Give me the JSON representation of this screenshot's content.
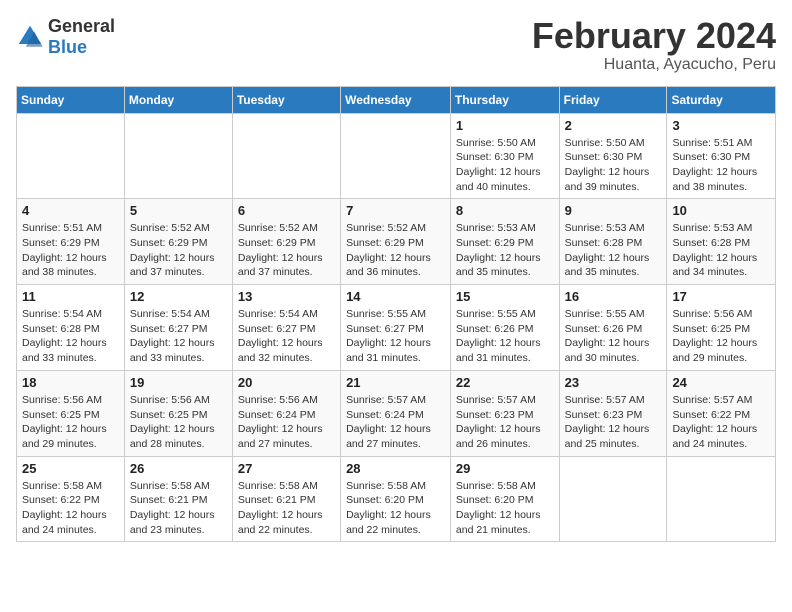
{
  "header": {
    "logo_general": "General",
    "logo_blue": "Blue",
    "month": "February 2024",
    "location": "Huanta, Ayacucho, Peru"
  },
  "days_of_week": [
    "Sunday",
    "Monday",
    "Tuesday",
    "Wednesday",
    "Thursday",
    "Friday",
    "Saturday"
  ],
  "weeks": [
    [
      {
        "day": "",
        "info": ""
      },
      {
        "day": "",
        "info": ""
      },
      {
        "day": "",
        "info": ""
      },
      {
        "day": "",
        "info": ""
      },
      {
        "day": "1",
        "info": "Sunrise: 5:50 AM\nSunset: 6:30 PM\nDaylight: 12 hours\nand 40 minutes."
      },
      {
        "day": "2",
        "info": "Sunrise: 5:50 AM\nSunset: 6:30 PM\nDaylight: 12 hours\nand 39 minutes."
      },
      {
        "day": "3",
        "info": "Sunrise: 5:51 AM\nSunset: 6:30 PM\nDaylight: 12 hours\nand 38 minutes."
      }
    ],
    [
      {
        "day": "4",
        "info": "Sunrise: 5:51 AM\nSunset: 6:29 PM\nDaylight: 12 hours\nand 38 minutes."
      },
      {
        "day": "5",
        "info": "Sunrise: 5:52 AM\nSunset: 6:29 PM\nDaylight: 12 hours\nand 37 minutes."
      },
      {
        "day": "6",
        "info": "Sunrise: 5:52 AM\nSunset: 6:29 PM\nDaylight: 12 hours\nand 37 minutes."
      },
      {
        "day": "7",
        "info": "Sunrise: 5:52 AM\nSunset: 6:29 PM\nDaylight: 12 hours\nand 36 minutes."
      },
      {
        "day": "8",
        "info": "Sunrise: 5:53 AM\nSunset: 6:29 PM\nDaylight: 12 hours\nand 35 minutes."
      },
      {
        "day": "9",
        "info": "Sunrise: 5:53 AM\nSunset: 6:28 PM\nDaylight: 12 hours\nand 35 minutes."
      },
      {
        "day": "10",
        "info": "Sunrise: 5:53 AM\nSunset: 6:28 PM\nDaylight: 12 hours\nand 34 minutes."
      }
    ],
    [
      {
        "day": "11",
        "info": "Sunrise: 5:54 AM\nSunset: 6:28 PM\nDaylight: 12 hours\nand 33 minutes."
      },
      {
        "day": "12",
        "info": "Sunrise: 5:54 AM\nSunset: 6:27 PM\nDaylight: 12 hours\nand 33 minutes."
      },
      {
        "day": "13",
        "info": "Sunrise: 5:54 AM\nSunset: 6:27 PM\nDaylight: 12 hours\nand 32 minutes."
      },
      {
        "day": "14",
        "info": "Sunrise: 5:55 AM\nSunset: 6:27 PM\nDaylight: 12 hours\nand 31 minutes."
      },
      {
        "day": "15",
        "info": "Sunrise: 5:55 AM\nSunset: 6:26 PM\nDaylight: 12 hours\nand 31 minutes."
      },
      {
        "day": "16",
        "info": "Sunrise: 5:55 AM\nSunset: 6:26 PM\nDaylight: 12 hours\nand 30 minutes."
      },
      {
        "day": "17",
        "info": "Sunrise: 5:56 AM\nSunset: 6:25 PM\nDaylight: 12 hours\nand 29 minutes."
      }
    ],
    [
      {
        "day": "18",
        "info": "Sunrise: 5:56 AM\nSunset: 6:25 PM\nDaylight: 12 hours\nand 29 minutes."
      },
      {
        "day": "19",
        "info": "Sunrise: 5:56 AM\nSunset: 6:25 PM\nDaylight: 12 hours\nand 28 minutes."
      },
      {
        "day": "20",
        "info": "Sunrise: 5:56 AM\nSunset: 6:24 PM\nDaylight: 12 hours\nand 27 minutes."
      },
      {
        "day": "21",
        "info": "Sunrise: 5:57 AM\nSunset: 6:24 PM\nDaylight: 12 hours\nand 27 minutes."
      },
      {
        "day": "22",
        "info": "Sunrise: 5:57 AM\nSunset: 6:23 PM\nDaylight: 12 hours\nand 26 minutes."
      },
      {
        "day": "23",
        "info": "Sunrise: 5:57 AM\nSunset: 6:23 PM\nDaylight: 12 hours\nand 25 minutes."
      },
      {
        "day": "24",
        "info": "Sunrise: 5:57 AM\nSunset: 6:22 PM\nDaylight: 12 hours\nand 24 minutes."
      }
    ],
    [
      {
        "day": "25",
        "info": "Sunrise: 5:58 AM\nSunset: 6:22 PM\nDaylight: 12 hours\nand 24 minutes."
      },
      {
        "day": "26",
        "info": "Sunrise: 5:58 AM\nSunset: 6:21 PM\nDaylight: 12 hours\nand 23 minutes."
      },
      {
        "day": "27",
        "info": "Sunrise: 5:58 AM\nSunset: 6:21 PM\nDaylight: 12 hours\nand 22 minutes."
      },
      {
        "day": "28",
        "info": "Sunrise: 5:58 AM\nSunset: 6:20 PM\nDaylight: 12 hours\nand 22 minutes."
      },
      {
        "day": "29",
        "info": "Sunrise: 5:58 AM\nSunset: 6:20 PM\nDaylight: 12 hours\nand 21 minutes."
      },
      {
        "day": "",
        "info": ""
      },
      {
        "day": "",
        "info": ""
      }
    ]
  ]
}
